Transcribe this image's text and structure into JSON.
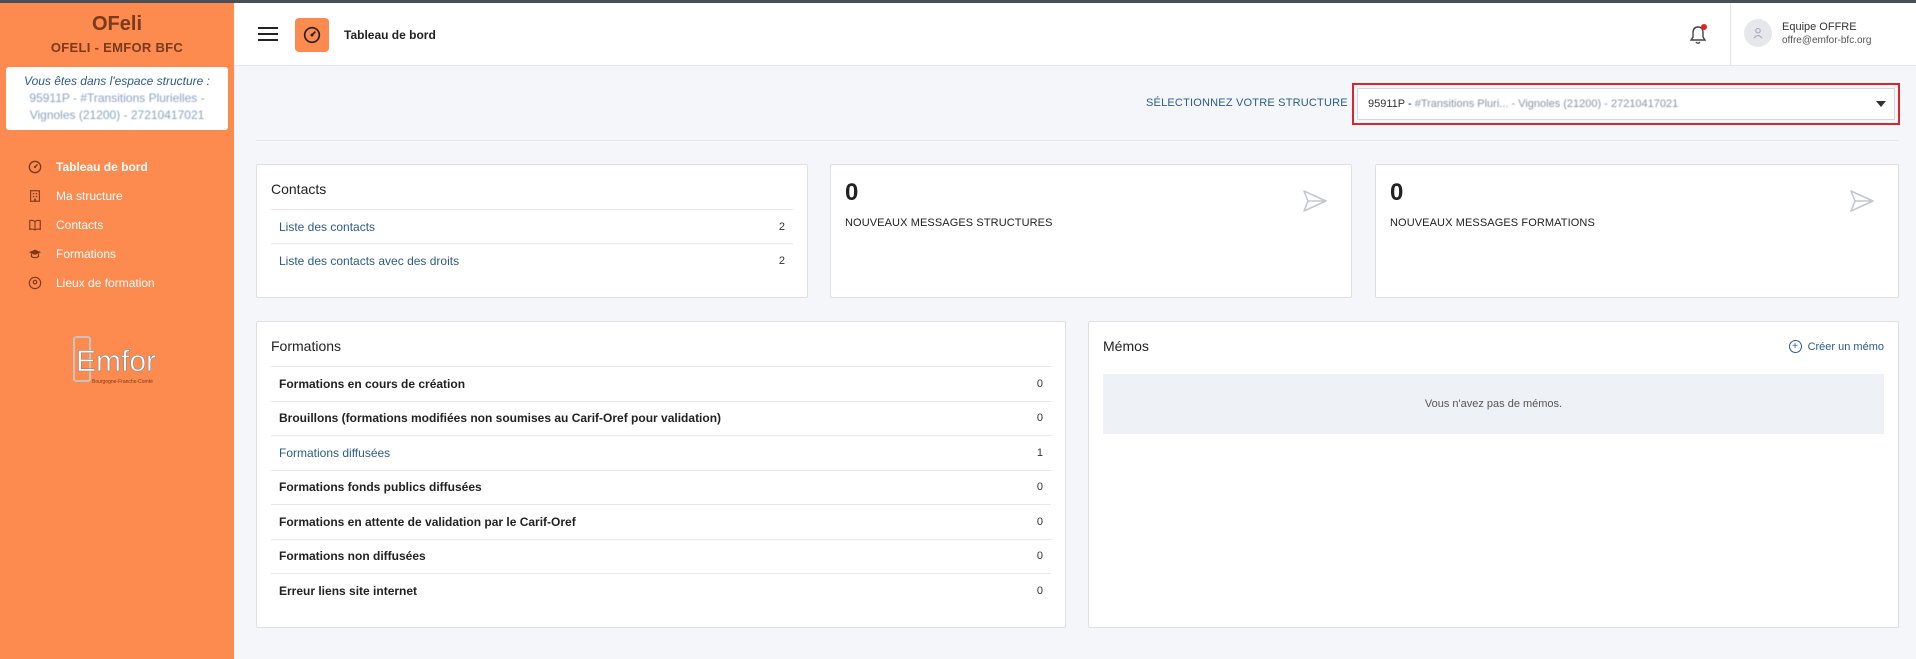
{
  "sidebar": {
    "app_name": "OFeli",
    "org_name": "OFELI - EMFOR BFC",
    "space_label": "Vous êtes dans l'espace structure :",
    "space_value": "95911P - #Transitions Plurielles - Vignoles (21200) - 27210417021",
    "items": [
      {
        "label": "Tableau de bord",
        "icon": "dashboard-icon"
      },
      {
        "label": "Ma structure",
        "icon": "building-icon"
      },
      {
        "label": "Contacts",
        "icon": "address-book-icon"
      },
      {
        "label": "Formations",
        "icon": "graduation-cap-icon"
      },
      {
        "label": "Lieux de formation",
        "icon": "location-pin-icon"
      }
    ],
    "logo_text": "Emfor",
    "logo_subtext": "Bourgogne-Franche-Comté"
  },
  "header": {
    "title": "Tableau de bord",
    "user_name": "Equipe OFFRE",
    "user_email": "offre@emfor-bfc.org"
  },
  "structure_select": {
    "label": "SÉLECTIONNEZ VOTRE STRUCTURE",
    "value_prefix": "95911P - ",
    "value_rest": "#Transitions Pluri... - Vignoles (21200) - 27210417021"
  },
  "contacts": {
    "title": "Contacts",
    "rows": [
      {
        "label": "Liste des contacts",
        "count": "2"
      },
      {
        "label": "Liste des contacts avec des droits",
        "count": "2"
      }
    ]
  },
  "messages": [
    {
      "count": "0",
      "caption": "NOUVEAUX MESSAGES STRUCTURES"
    },
    {
      "count": "0",
      "caption": "NOUVEAUX MESSAGES FORMATIONS"
    }
  ],
  "formations": {
    "title": "Formations",
    "rows": [
      {
        "label": "Formations en cours de création",
        "count": "0"
      },
      {
        "label": "Brouillons (formations modifiées non soumises au Carif-Oref pour validation)",
        "count": "0"
      },
      {
        "label": "Formations diffusées",
        "count": "1"
      },
      {
        "label": "Formations fonds publics diffusées",
        "count": "0"
      },
      {
        "label": "Formations en attente de validation par le Carif-Oref",
        "count": "0"
      },
      {
        "label": "Formations non diffusées",
        "count": "0"
      },
      {
        "label": "Erreur liens site internet",
        "count": "0"
      }
    ]
  },
  "memos": {
    "title": "Mémos",
    "create_label": "Créer un mémo",
    "empty_text": "Vous n'avez pas de mémos."
  },
  "colors": {
    "sidebar_bg": "#fd8a4f",
    "link": "#2e5b8a",
    "highlight_border": "#d9262c"
  }
}
